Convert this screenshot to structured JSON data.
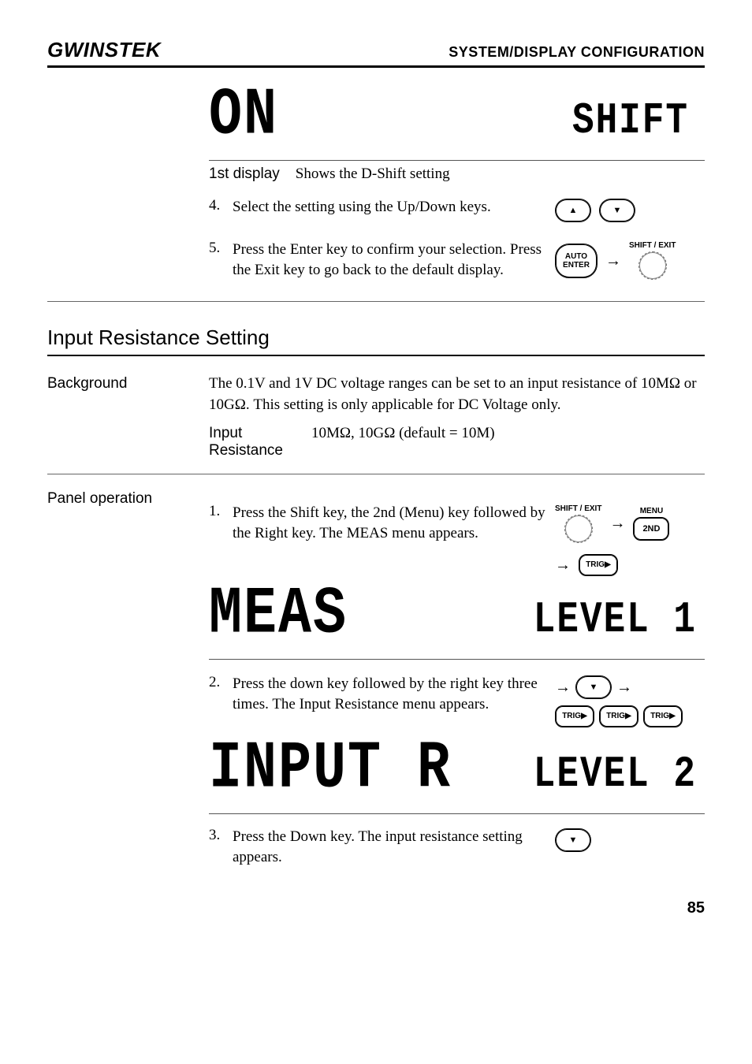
{
  "header": {
    "brand": "GWINSTEK",
    "title": "SYSTEM/DISPLAY CONFIGURATION"
  },
  "seg1": {
    "primary": "ON",
    "secondary": "SHIFT",
    "caption_label": "1st display",
    "caption_text": "Shows the D-Shift setting"
  },
  "step4": {
    "num": "4.",
    "text": "Select the setting using the Up/Down keys."
  },
  "step5": {
    "num": "5.",
    "text": "Press the Enter key to confirm your selection. Press the Exit key to go back to the default display.",
    "key1_top": "AUTO",
    "key1_bot": "ENTER",
    "key2_label": "SHIFT / EXIT"
  },
  "section": {
    "title": "Input Resistance Setting"
  },
  "background": {
    "label": "Background",
    "text": "The 0.1V and 1V DC voltage ranges can be set to an input resistance of 10MΩ or 10GΩ. This setting is only applicable for DC Voltage only.",
    "sub_label": "Input Resistance",
    "sub_value": "10MΩ, 10GΩ (default = 10M)"
  },
  "panel": {
    "label": "Panel operation",
    "s1": {
      "num": "1.",
      "text": "Press the Shift key, the 2nd (Menu) key followed by the Right key. The MEAS menu appears.",
      "k_shift": "SHIFT / EXIT",
      "k_menu": "MENU",
      "k_2nd": "2ND",
      "k_trig": "TRIG▶"
    },
    "seg": {
      "primary": "MEAS",
      "secondary": "LEVEL 1"
    },
    "s2": {
      "num": "2.",
      "text": "Press the down key followed by the right key three times. The Input Resistance menu appears.",
      "k_trig": "TRIG▶"
    },
    "seg2": {
      "primary": "INPUT  R",
      "secondary": "LEVEL 2"
    },
    "s3": {
      "num": "3.",
      "text": "Press the Down key. The input resistance setting appears."
    }
  },
  "page_number": "85"
}
